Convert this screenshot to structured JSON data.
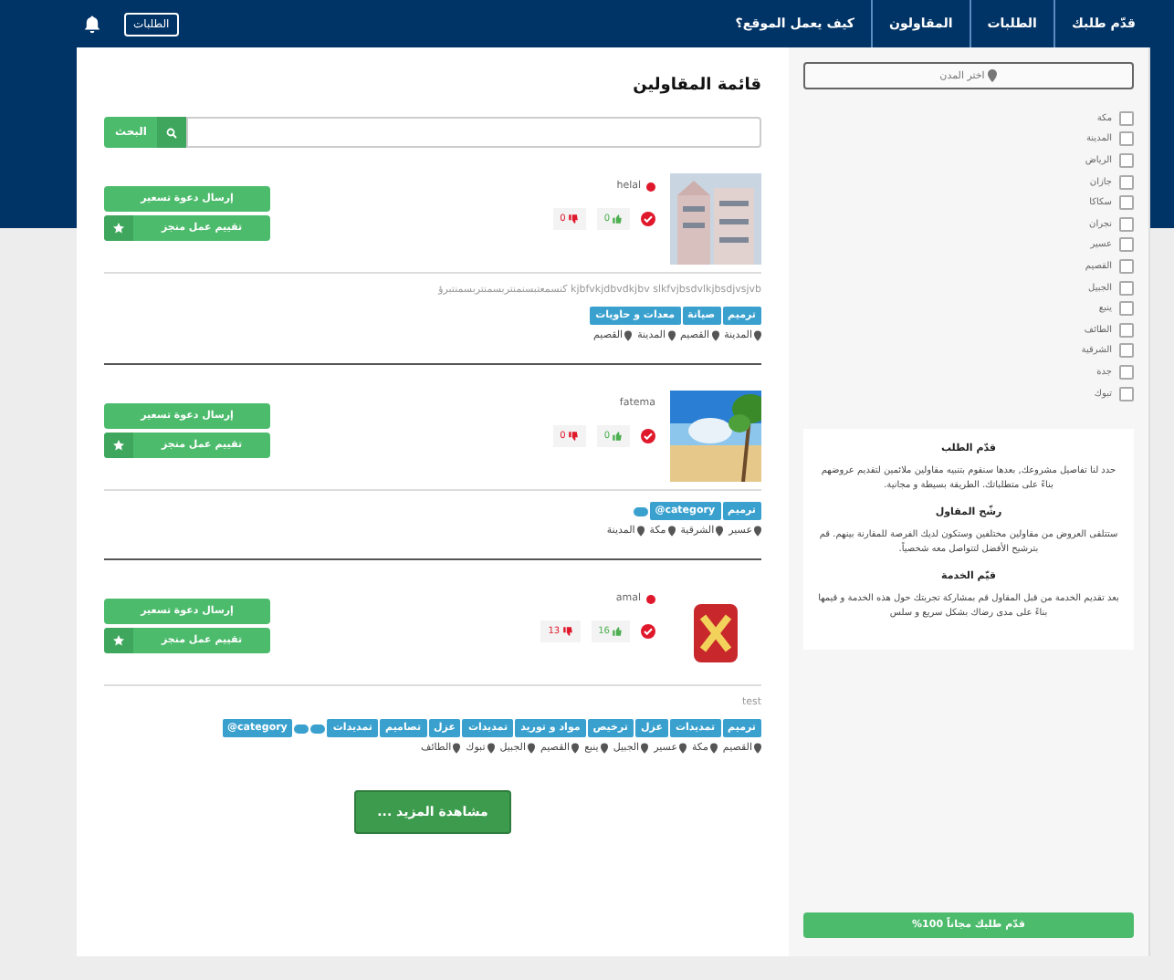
{
  "nav": {
    "links": [
      {
        "label": "قدّم طلبك"
      },
      {
        "label": "الطلبات"
      },
      {
        "label": "المقاولون"
      },
      {
        "label": "كيف يعمل الموقع؟"
      }
    ],
    "requests_button": "الطلبات"
  },
  "sidebar": {
    "city_select": {
      "placeholder": "اختر المدن"
    },
    "cities": [
      {
        "label": "مكة",
        "checked": false
      },
      {
        "label": "المدينة",
        "checked": false
      },
      {
        "label": "الرياض",
        "checked": false
      },
      {
        "label": "جازان",
        "checked": false
      },
      {
        "label": "سكاكا",
        "checked": false
      },
      {
        "label": "نجران",
        "checked": false
      },
      {
        "label": "عسير",
        "checked": false
      },
      {
        "label": "القصيم",
        "checked": false
      },
      {
        "label": "الجبيل",
        "checked": false
      },
      {
        "label": "ينبع",
        "checked": false
      },
      {
        "label": "الطائف",
        "checked": false
      },
      {
        "label": "الشرقية",
        "checked": false
      },
      {
        "label": "جدة",
        "checked": false
      },
      {
        "label": "تبوك",
        "checked": false
      }
    ],
    "steps": [
      {
        "title": "قدّم الطلب",
        "text": "حدد لنا تفاصيل مشروعك, بعدها سنقوم بتنبيه مقاولين ملائمين لتقديم عروضهم بناءً على متطلباتك. الطريقة بسيطة و مجانية."
      },
      {
        "title": "رشّح المقاول",
        "text": "ستتلقى العروض من مقاولين مختلفين وستكون لديك الفرصة للمقارنة بينهم. قم بترشيح الأفضل لتتواصل معه شخصياً."
      },
      {
        "title": "قيّم الخدمة",
        "text": "بعد تقديم الخدمة من قبل المقاول قم بمشاركة تجربتك حول هذه الخدمة و قيمها بناءً على مدى رضاك بشكل سريع و سلس"
      }
    ],
    "cta": "قدّم طلبك مجاناً 100%"
  },
  "main": {
    "title": "قائمة المقاولين",
    "search": {
      "button": "البحث"
    },
    "contractors": [
      {
        "name": "helal",
        "dot": true,
        "image": {
          "kind": "picture"
        },
        "verified": true,
        "likes": "0",
        "dislikes": "0",
        "invite_button": "إرسال دعوة تسعير",
        "rate_button": "تقييم عمل منجز",
        "description": "kjbfvkjdbvdkjbv slkfvjbsdvlkjbsdjvsjvb كنسمعتبسنمنتربسمنتربسمنتبرؤ",
        "tags": [
          {
            "kind": "label",
            "text": "ترميم"
          },
          {
            "kind": "label",
            "text": "صيانة"
          },
          {
            "kind": "label",
            "text": "معدات و حاويات"
          }
        ],
        "locations": [
          "المدينة",
          "القصيم",
          "المدينة",
          "القصيم"
        ]
      },
      {
        "name": "fatema",
        "dot": false,
        "image": {
          "kind": "picture"
        },
        "verified": true,
        "likes": "0",
        "dislikes": "0",
        "invite_button": "إرسال دعوة تسعير",
        "rate_button": "تقييم عمل منجز",
        "tags": [
          {
            "kind": "label",
            "text": "ترميم"
          },
          {
            "kind": "label",
            "text": "category@"
          },
          {
            "kind": "blank"
          }
        ],
        "locations": [
          "عسير",
          "الشرقية",
          "مكة",
          "المدينة"
        ]
      },
      {
        "name": "amal",
        "dot": true,
        "image": {
          "kind": "logo"
        },
        "verified": true,
        "likes": "16",
        "dislikes": "13",
        "invite_button": "إرسال دعوة تسعير",
        "rate_button": "تقييم عمل منجز",
        "description": "test",
        "tags": [
          {
            "kind": "label",
            "text": "ترميم"
          },
          {
            "kind": "label",
            "text": "تمديدات"
          },
          {
            "kind": "label",
            "text": "عزل"
          },
          {
            "kind": "label",
            "text": "ترخيص"
          },
          {
            "kind": "label",
            "text": "مواد و توريد"
          },
          {
            "kind": "label",
            "text": "تمديدات"
          },
          {
            "kind": "label",
            "text": "عزل"
          },
          {
            "kind": "label",
            "text": "تصاميم"
          },
          {
            "kind": "label",
            "text": "تمديدات"
          },
          {
            "kind": "blank"
          },
          {
            "kind": "blank"
          },
          {
            "kind": "label",
            "text": "category@"
          }
        ],
        "locations": [
          "القصيم",
          "مكة",
          "عسير",
          "الجبيل",
          "ينبع",
          "القصيم",
          "الجبيل",
          "تبوك",
          "الطائف"
        ]
      }
    ],
    "more_button": "مشاهدة المزيد ..."
  }
}
